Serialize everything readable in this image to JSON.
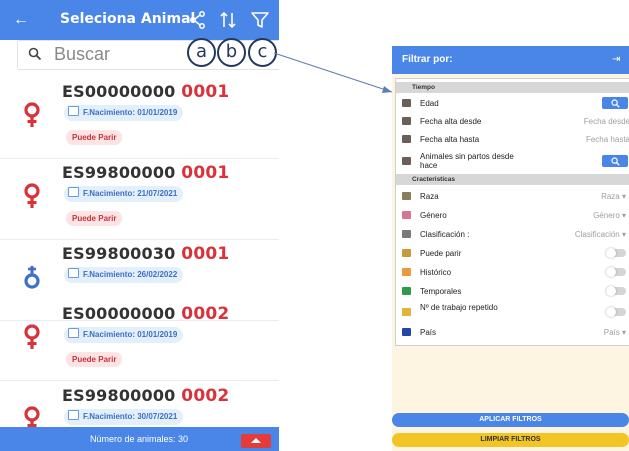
{
  "phone": {
    "title": "Seleciona Animal",
    "search_placeholder": "Buscar",
    "labels": [
      "a",
      "b",
      "c"
    ],
    "animals": [
      {
        "prefix": "ES00000000",
        "suffix": "0001",
        "sex": "female",
        "birth": "F.Nacimiento: 01/01/2019",
        "tag": "Puede Parir"
      },
      {
        "prefix": "ES99800000",
        "suffix": "0001",
        "sex": "female",
        "birth": "F.Nacimiento: 21/07/2021",
        "tag": "Puede Parir"
      },
      {
        "prefix": "ES99800030",
        "suffix": "0001",
        "sex": "male",
        "birth": "F.Nacimiento: 26/02/2022",
        "tag": ""
      },
      {
        "prefix": "ES00000000",
        "suffix": "0002",
        "sex": "female",
        "birth": "F.Nacimiento: 01/01/2019",
        "tag": "Puede Parir"
      },
      {
        "prefix": "ES99800000",
        "suffix": "0002",
        "sex": "female",
        "birth": "F.Nacimiento: 30/07/2021",
        "tag": ""
      }
    ],
    "footer_count": "Número de animales: 30"
  },
  "filter": {
    "title": "Filtrar por:",
    "section_tiempo": "Tiempo",
    "section_caracteristicas": "Cracteristicas",
    "edad": "Edad",
    "fecha_alta_desde": "Fecha alta desde",
    "fecha_alta_desde_value": "Fecha desde",
    "fecha_alta_hasta": "Fecha alta hasta",
    "fecha_alta_hasta_value": "Fecha hasta",
    "animales_sin_partos": "Animales sin partos desde hace",
    "raza": "Raza",
    "raza_value": "Raza ▾",
    "genero": "Género",
    "genero_value": "Género ▾",
    "clasificacion": "Clasificación :",
    "clasificacion_value": "Clasificación ▾",
    "puede_parir": "Puede parir",
    "historico": "Histórico",
    "temporales": "Temporales",
    "n_trabajo": "Nº de trabajo repetido",
    "pais": "País",
    "pais_value": "País ▾",
    "apply_label": "APLICAR FILTROS",
    "clear_label": "LIMPIAR FILTROS"
  },
  "colors": {
    "primary": "#4a86e8",
    "female": "#d9323a",
    "male": "#3b6fd1",
    "accent_yellow": "#f2c524",
    "panel_bg": "#fdf5e1"
  }
}
